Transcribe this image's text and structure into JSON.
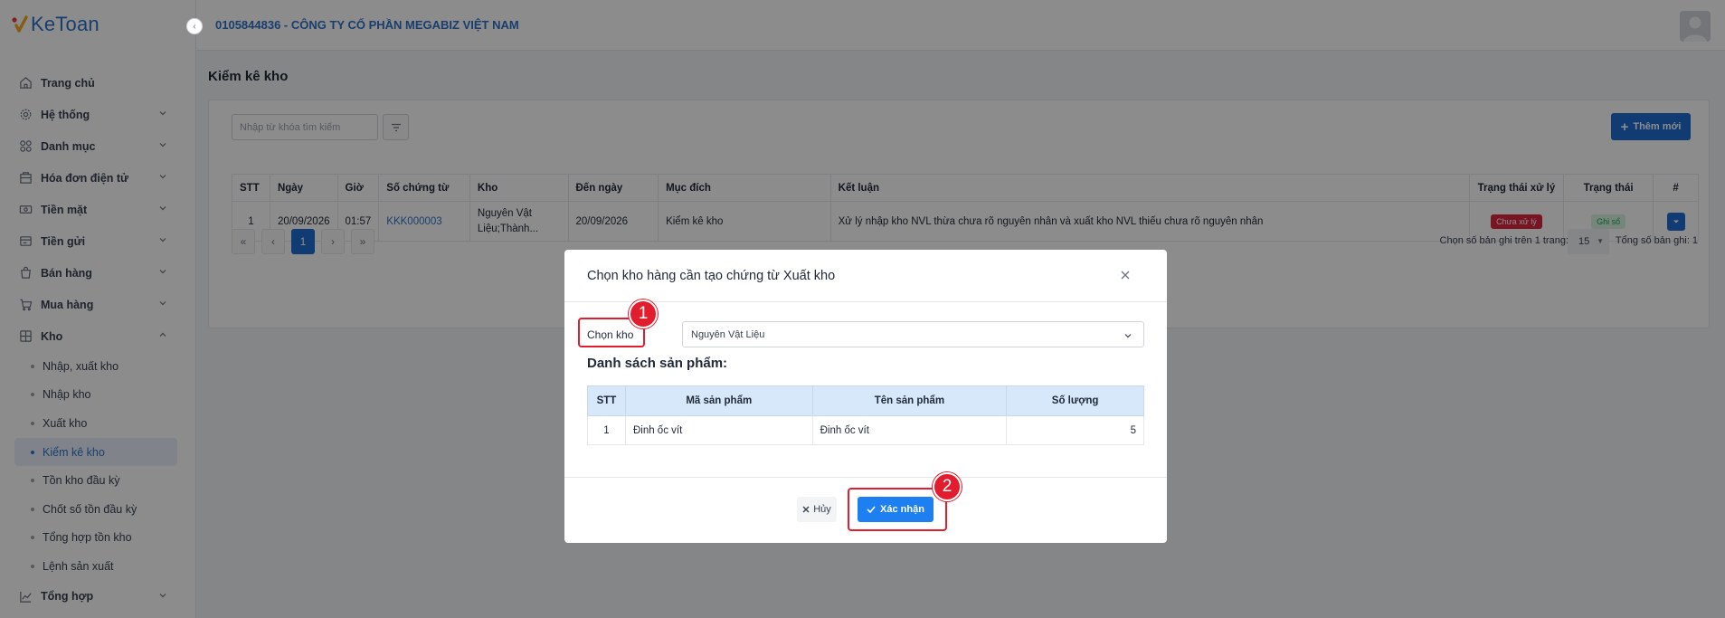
{
  "app": {
    "logo_text": "KeToan"
  },
  "topbar": {
    "company": "0105844836 - CÔNG TY CỔ PHẦN MEGABIZ VIỆT NAM"
  },
  "sidebar": {
    "items": [
      {
        "label": "Trang chủ",
        "icon": "home-icon"
      },
      {
        "label": "Hệ thống",
        "icon": "gear-icon"
      },
      {
        "label": "Danh mục",
        "icon": "grid-icon"
      },
      {
        "label": "Hóa đơn điện tử",
        "icon": "invoice-icon"
      },
      {
        "label": "Tiền mặt",
        "icon": "cash-icon"
      },
      {
        "label": "Tiền gửi",
        "icon": "bank-icon"
      },
      {
        "label": "Bán hàng",
        "icon": "sales-icon"
      },
      {
        "label": "Mua hàng",
        "icon": "cart-icon"
      },
      {
        "label": "Kho",
        "icon": "warehouse-icon"
      }
    ],
    "kho_sub": [
      "Nhập, xuất kho",
      "Nhập kho",
      "Xuất kho",
      "Kiểm kê kho",
      "Tồn kho đầu kỳ",
      "Chốt số tồn đầu kỳ",
      "Tổng hợp tồn kho",
      "Lệnh sản xuất"
    ],
    "last": {
      "label": "Tổng hợp",
      "icon": "chart-icon"
    }
  },
  "page": {
    "title": "Kiểm kê kho",
    "search_placeholder": "Nhập từ khóa tìm kiếm",
    "add_label": "Thêm mới",
    "columns": [
      "STT",
      "Ngày",
      "Giờ",
      "Số chứng từ",
      "Kho",
      "Đến ngày",
      "Mục đích",
      "Kết luận",
      "Trạng thái xử lý",
      "Trạng thái",
      "#"
    ],
    "rows": [
      {
        "stt": "1",
        "ngay": "20/09/2026",
        "gio": "01:57",
        "so_ct": "KKK000003",
        "kho_1": "Nguyên Vật",
        "kho_2": "Liệu;Thành...",
        "den_ngay": "20/09/2026",
        "muc_dich": "Kiểm kê kho",
        "ket_luan": "Xử lý nhập kho NVL thừa chưa rõ nguyên nhân và xuất kho NVL thiếu chưa rõ nguyên nhân",
        "tt_xu_ly": "Chưa xử lý",
        "trang_thai": "Ghi sổ"
      }
    ],
    "pagination": {
      "current": "1",
      "page_size_label": "Chọn số bản ghi trên 1 trang:",
      "page_size": "15",
      "total_label": "Tổng số bản ghi:",
      "total": "1"
    }
  },
  "modal": {
    "title": "Chọn kho hàng cần tạo chứng từ Xuất kho",
    "kho_label": "Chọn kho",
    "kho_value": "Nguyên Vật Liệu",
    "list_title": "Danh sách sản phẩm:",
    "columns": [
      "STT",
      "Mã sản phẩm",
      "Tên sản phẩm",
      "Số lượng"
    ],
    "rows": [
      {
        "stt": "1",
        "ma": "Đinh ốc vít",
        "ten": "Đinh ốc vít",
        "sl": "5"
      }
    ],
    "cancel_label": "Hủy",
    "confirm_label": "Xác nhận"
  },
  "annotations": {
    "step1": "1",
    "step2": "2",
    "highlight_color": "#e11d2e"
  },
  "colors": {
    "primary": "#1e6cd2",
    "brand": "#2f72c7",
    "danger": "#dc2640",
    "success": "#16a34a"
  }
}
